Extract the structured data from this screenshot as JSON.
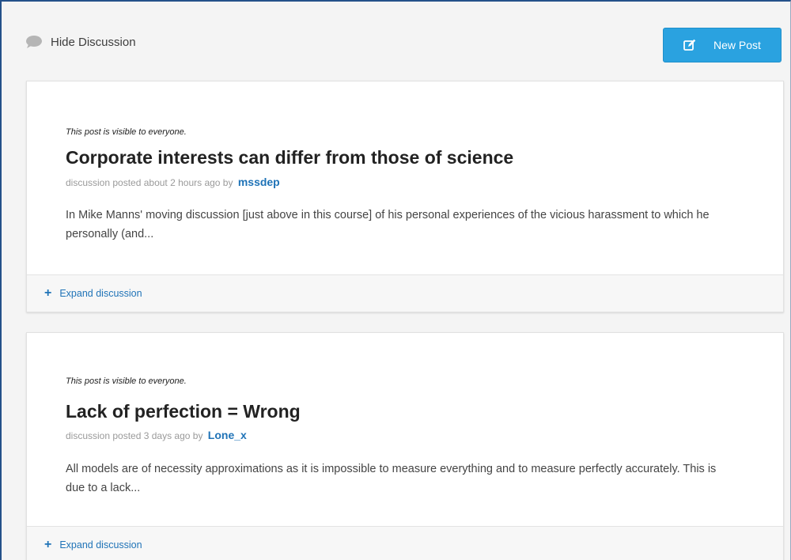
{
  "header": {
    "hide_discussion_label": "Hide Discussion",
    "new_post_label": "New Post"
  },
  "posts": [
    {
      "visibility": "This post is visible to everyone.",
      "title": "Corporate interests can differ from those of science",
      "meta_prefix": "discussion posted about 2 hours ago by",
      "author": "mssdep",
      "excerpt": "In Mike Manns' moving discussion [just above in this course] of his personal experiences of the vicious harassment to which he personally (and...",
      "expand_label": "Expand discussion"
    },
    {
      "visibility": "This post is visible to everyone.",
      "title": "Lack of perfection = Wrong",
      "meta_prefix": "discussion posted 3 days ago by",
      "author": "Lone_x",
      "excerpt": "All models are of necessity approximations as it is impossible to measure everything and to measure perfectly accurately. This is due to a lack...",
      "expand_label": "Expand discussion"
    }
  ],
  "colors": {
    "accent": "#2aa2e0",
    "link": "#1f73b7",
    "window_border": "#24518a"
  },
  "icons": {
    "discussion": "speech-bubble-icon",
    "new_post": "edit-icon",
    "expand": "plus-icon"
  }
}
